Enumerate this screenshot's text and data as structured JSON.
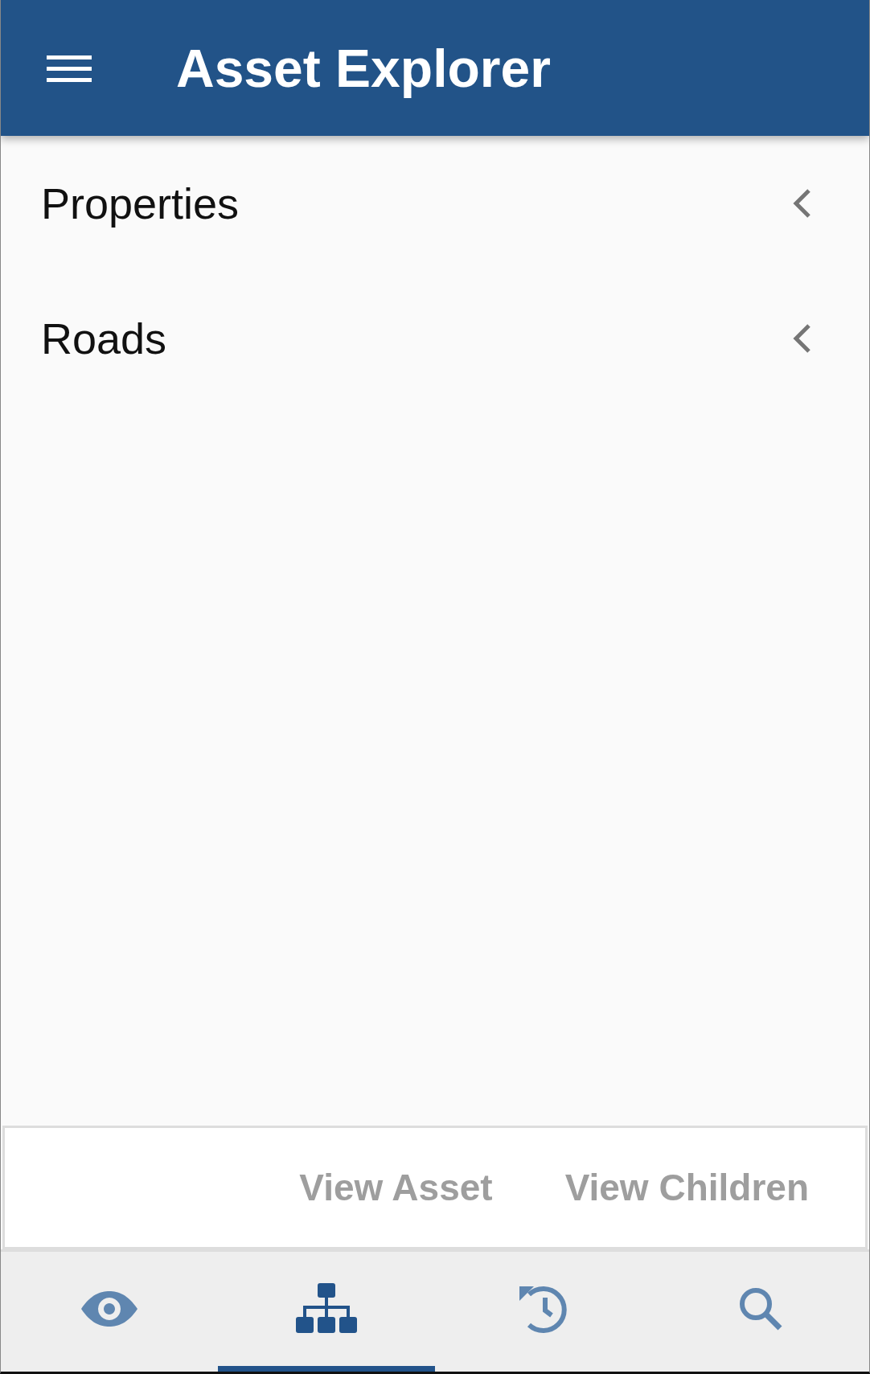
{
  "app_bar": {
    "title": "Asset Explorer"
  },
  "tree": {
    "items": [
      {
        "label": "Properties",
        "expanded": false
      },
      {
        "label": "Roads",
        "expanded": false
      }
    ]
  },
  "actions": [
    {
      "label": "View Asset",
      "disabled": true
    },
    {
      "label": "View Children",
      "disabled": true
    }
  ],
  "bottom_nav": [
    {
      "kind": "eye",
      "selected": false
    },
    {
      "kind": "hierarchy",
      "selected": true
    },
    {
      "kind": "history",
      "selected": false
    },
    {
      "kind": "search",
      "selected": false
    }
  ]
}
